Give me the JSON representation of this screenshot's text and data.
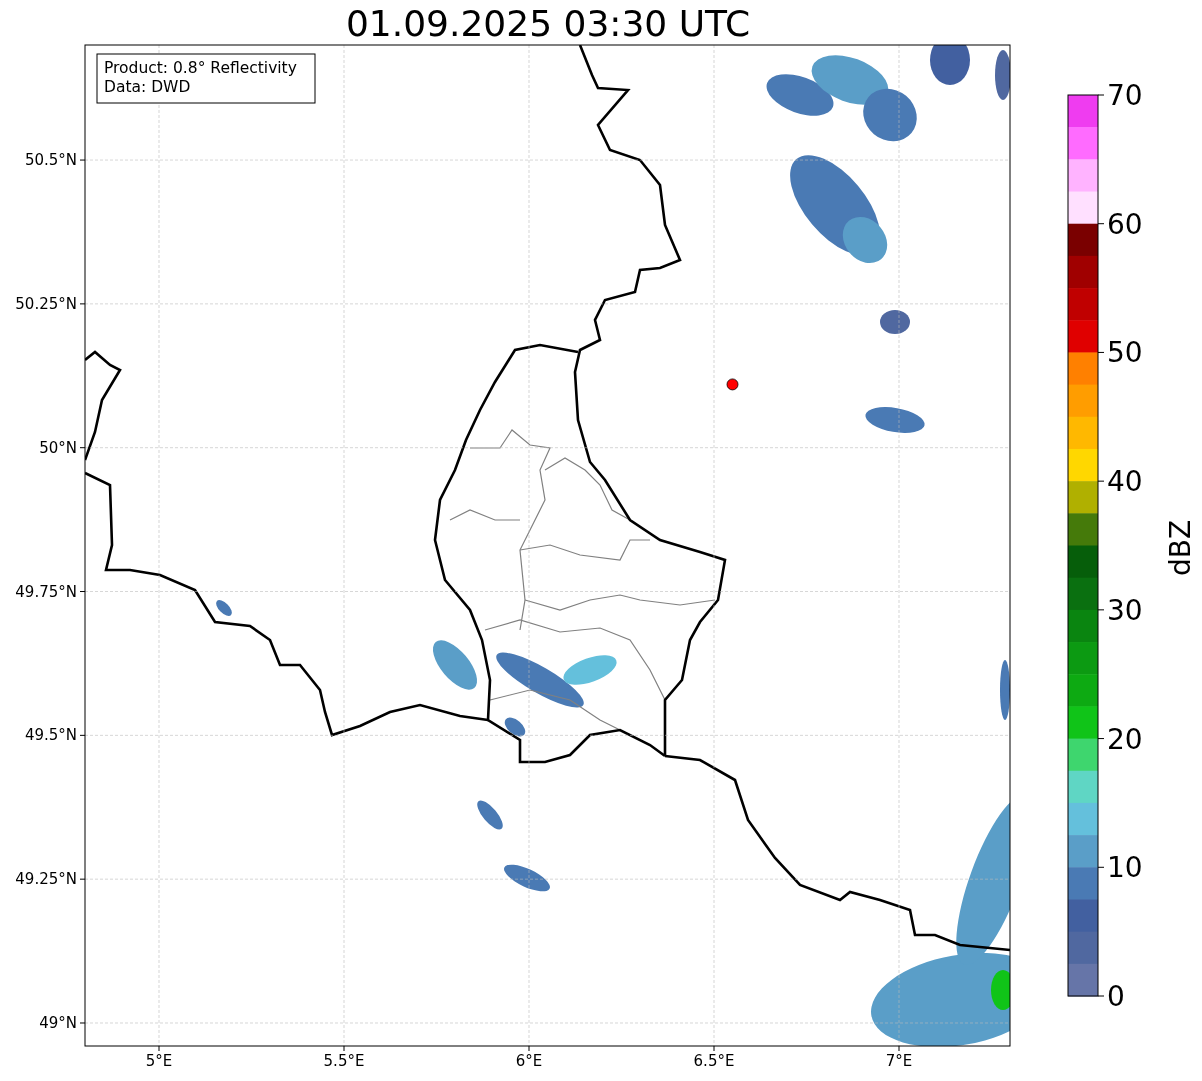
{
  "chart_data": {
    "type": "scatter",
    "title": "01.09.2025 03:30 UTC",
    "grid": true,
    "xlim": [
      4.8,
      7.3
    ],
    "ylim": [
      48.96,
      50.7
    ],
    "xticks": [
      {
        "value": 5,
        "label": "5°E"
      },
      {
        "value": 5.5,
        "label": "5.5°E"
      },
      {
        "value": 6,
        "label": "6°E"
      },
      {
        "value": 6.5,
        "label": "6.5°E"
      },
      {
        "value": 7,
        "label": "7°E"
      }
    ],
    "yticks": [
      {
        "value": 49,
        "label": "49°N"
      },
      {
        "value": 49.25,
        "label": "49.25°N"
      },
      {
        "value": 49.5,
        "label": "49.5°N"
      },
      {
        "value": 49.75,
        "label": "49.75°N"
      },
      {
        "value": 50,
        "label": "50°N"
      },
      {
        "value": 50.25,
        "label": "50.25°N"
      },
      {
        "value": 50.5,
        "label": "50.5°N"
      }
    ],
    "x": [
      6.55
    ],
    "series": [
      {
        "color": "#ff0000",
        "values": [
          50.11
        ]
      }
    ]
  },
  "info_box": [
    "Product: 0.8° Reflectivity",
    "Data: DWD"
  ],
  "colorbar": {
    "label": "dBZ",
    "ticks": [
      "70",
      "60",
      "50",
      "40",
      "30",
      "20",
      "10",
      "0"
    ],
    "bins": [
      {
        "color": "#ef3cf0"
      },
      {
        "color": "#ff6bff"
      },
      {
        "color": "#ffb3ff"
      },
      {
        "color": "#ffe0ff"
      },
      {
        "color": "#7a0000"
      },
      {
        "color": "#a00000"
      },
      {
        "color": "#c00000"
      },
      {
        "color": "#e00000"
      },
      {
        "color": "#ff8000"
      },
      {
        "color": "#ff9d00"
      },
      {
        "color": "#ffb800"
      },
      {
        "color": "#ffd700"
      },
      {
        "color": "#b0b000"
      },
      {
        "color": "#457a0a"
      },
      {
        "color": "#065e0a"
      },
      {
        "color": "#0a7010"
      },
      {
        "color": "#0a8510"
      },
      {
        "color": "#0c9a12"
      },
      {
        "color": "#0daa12"
      },
      {
        "color": "#10c418"
      },
      {
        "color": "#3ed66e"
      },
      {
        "color": "#5fd6c4"
      },
      {
        "color": "#64c0dc"
      },
      {
        "color": "#5a9ec8"
      },
      {
        "color": "#4a7ab4"
      },
      {
        "color": "#4260a0"
      },
      {
        "color": "#5068a0"
      },
      {
        "color": "#6675a8"
      }
    ]
  }
}
